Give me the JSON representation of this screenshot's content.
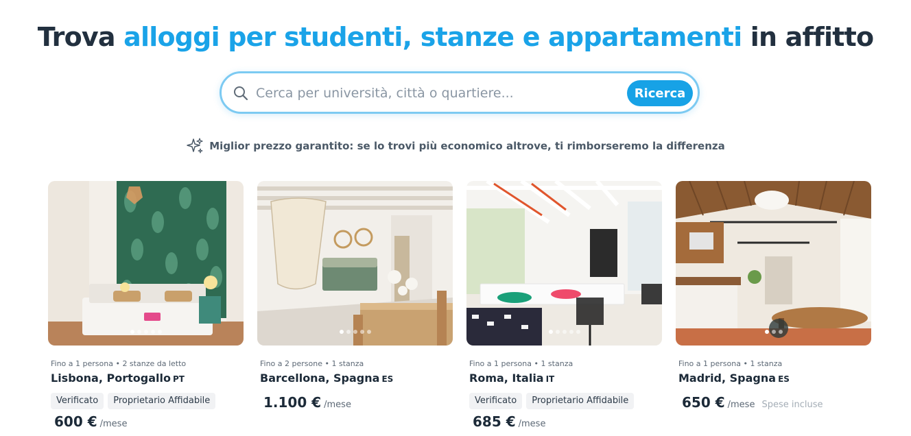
{
  "hero": {
    "title_start": "Trova ",
    "title_accent": "alloggi per studenti, stanze e appartamenti",
    "title_end": " in affitto"
  },
  "search": {
    "placeholder": "Cerca per università, città o quartiere...",
    "button_label": "Ricerca",
    "icon": "search-icon"
  },
  "guarantee": {
    "icon": "sparkle-icon",
    "text": "Miglior prezzo garantito: se lo trovi più economico altrove, ti rimborseremo la differenza"
  },
  "colors": {
    "accent": "#1aa3e8",
    "button": "#17a2e6",
    "title": "#22303f"
  },
  "listings": [
    {
      "meta": "Fino a 1 persona • 2 stanze da letto",
      "city": "Lisbona, Portogallo",
      "country_code": "PT",
      "tags": [
        "Verificato",
        "Proprietario Affidabile"
      ],
      "price": "600 €",
      "per": "/mese",
      "extra": ""
    },
    {
      "meta": "Fino a 2 persone • 1 stanza",
      "city": "Barcellona, Spagna",
      "country_code": "ES",
      "tags": [],
      "price": "1.100 €",
      "per": "/mese",
      "extra": ""
    },
    {
      "meta": "Fino a 1 persona • 1 stanza",
      "city": "Roma, Italia",
      "country_code": "IT",
      "tags": [
        "Verificato",
        "Proprietario Affidabile"
      ],
      "price": "685 €",
      "per": "/mese",
      "extra": ""
    },
    {
      "meta": "Fino a 1 persona • 1 stanza",
      "city": "Madrid, Spagna",
      "country_code": "ES",
      "tags": [],
      "price": "650 €",
      "per": "/mese",
      "extra": "Spese incluse"
    }
  ]
}
